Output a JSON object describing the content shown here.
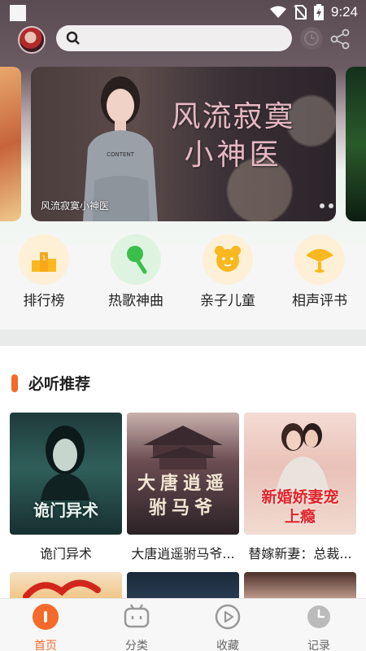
{
  "status_bar": {
    "time": "9:24"
  },
  "search": {
    "placeholder": ""
  },
  "banner": {
    "title_line1": "风流寂寞",
    "title_line2": "小神医",
    "caption": "风流寂寞小神医",
    "left_peek_text": "",
    "dots": 3
  },
  "categories": [
    {
      "label": "排行榜",
      "icon": "ranking-icon"
    },
    {
      "label": "热歌神曲",
      "icon": "microphone-icon"
    },
    {
      "label": "亲子儿童",
      "icon": "bear-icon"
    },
    {
      "label": "相声评书",
      "icon": "fan-icon"
    }
  ],
  "section": {
    "title": "必听推荐",
    "books": [
      {
        "name": "诡门异术",
        "cover_text": "诡门异术"
      },
      {
        "name": "大唐逍遥驸马爷...",
        "cover_text": "大唐逍遥驸马爷"
      },
      {
        "name": "替嫁新妻：总裁...",
        "cover_text": "新婚娇妻宠上瘾"
      }
    ]
  },
  "tabs": [
    {
      "label": "首页",
      "icon": "home-icon",
      "active": true
    },
    {
      "label": "分类",
      "icon": "category-icon",
      "active": false
    },
    {
      "label": "收藏",
      "icon": "play-icon",
      "active": false
    },
    {
      "label": "记录",
      "icon": "clock-icon",
      "active": false
    }
  ],
  "colors": {
    "accent": "#f36a2a",
    "icon_yellow": "#f9b81f",
    "icon_green": "#3bbf4a"
  }
}
